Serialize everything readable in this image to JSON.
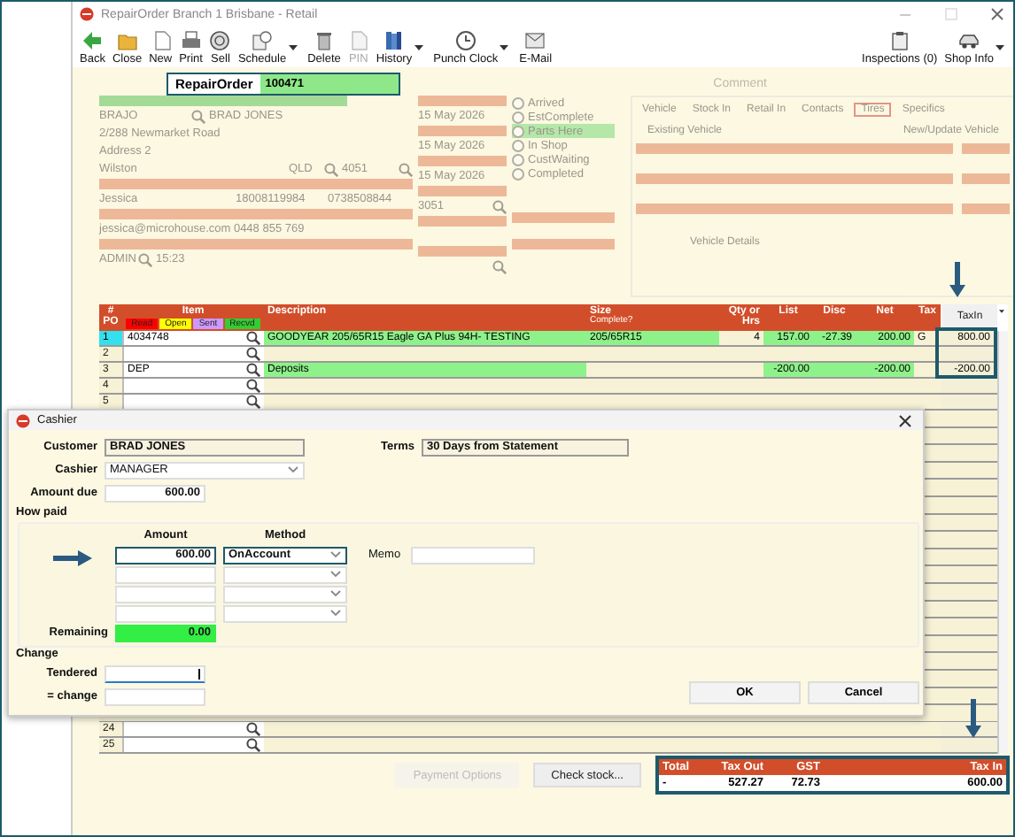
{
  "window": {
    "title": "RepairOrder  Branch 1  Brisbane - Retail"
  },
  "toolbar": [
    {
      "label": "Back",
      "disabled": false,
      "dropdown": false
    },
    {
      "label": "Close",
      "disabled": false,
      "dropdown": false
    },
    {
      "label": "New",
      "disabled": false,
      "dropdown": false
    },
    {
      "label": "Print",
      "disabled": false,
      "dropdown": false
    },
    {
      "label": "Sell",
      "disabled": false,
      "dropdown": false
    },
    {
      "label": "Schedule",
      "disabled": false,
      "dropdown": true
    },
    {
      "label": "Delete",
      "disabled": false,
      "dropdown": false
    },
    {
      "label": "PIN",
      "disabled": true,
      "dropdown": false
    },
    {
      "label": "History",
      "disabled": false,
      "dropdown": true
    },
    {
      "label": "Punch Clock",
      "disabled": false,
      "dropdown": true
    },
    {
      "label": "E-Mail",
      "disabled": false,
      "dropdown": false
    }
  ],
  "toolbar_right": [
    {
      "label": "Inspections (0)",
      "dropdown": false
    },
    {
      "label": "Shop Info",
      "dropdown": true
    }
  ],
  "record": {
    "label": "RepairOrder",
    "number": "100471"
  },
  "background": {
    "comment_label": "Comment",
    "customer_code": "BRAJO",
    "customer_name": "BRAD JONES",
    "address_1": "2/288 Newmarket Road",
    "address_2": "Address 2",
    "suburb": "Wilston",
    "state": "QLD",
    "postcode": "4051",
    "contact": "Jessica",
    "phone_1": "18008119984",
    "phone_2": "0738508844",
    "email": "jessica@microhouse.com 0448 855 769",
    "user": "ADMIN",
    "time": "15:23",
    "dates": [
      "15 May 2026",
      "15 May 2026",
      "15 May 2026"
    ],
    "code": "3051",
    "statuses": [
      {
        "label": "Arrived",
        "selected": false
      },
      {
        "label": "EstComplete",
        "selected": false
      },
      {
        "label": "Parts Here",
        "selected": true
      },
      {
        "label": "In Shop",
        "selected": false
      },
      {
        "label": "CustWaiting",
        "selected": false
      },
      {
        "label": "Completed",
        "selected": false
      }
    ],
    "tabs": [
      {
        "label": "Vehicle",
        "selected": false
      },
      {
        "label": "Stock In",
        "selected": false
      },
      {
        "label": "Retail In",
        "selected": false
      },
      {
        "label": "Contacts",
        "selected": false
      },
      {
        "label": "Tires",
        "selected": true
      },
      {
        "label": "Specifics",
        "selected": false
      }
    ],
    "vehicle_buttons": [
      "Existing Vehicle",
      "New/Update Vehicle"
    ],
    "details_button": "Vehicle Details"
  },
  "grid": {
    "columns": [
      {
        "label": "#",
        "sublabel": "PO"
      },
      {
        "label": "Item"
      },
      {
        "label": "Description"
      },
      {
        "label": "Size",
        "sublabel": "Complete?"
      },
      {
        "label": "Qty or Hrs"
      },
      {
        "label": "List"
      },
      {
        "label": "Disc"
      },
      {
        "label": "Net"
      },
      {
        "label": "Tax"
      },
      {
        "label": "TaxIn"
      }
    ],
    "legend": [
      {
        "label": "Read",
        "color": "#ff0000"
      },
      {
        "label": "Open",
        "color": "#ffff00"
      },
      {
        "label": "Sent",
        "color": "#cc99ff"
      },
      {
        "label": "Recvd",
        "color": "#33cc33"
      }
    ],
    "rows": [
      {
        "number": "1",
        "selected": true,
        "matched": true,
        "item": "4034748",
        "description": "GOODYEAR 205/65R15 Eagle GA Plus 94H- TESTING",
        "size": "205/65R15",
        "qty": "4",
        "list": "157.00",
        "disc": "-27.39",
        "net": "200.00",
        "tax": "G",
        "taxin": "800.00"
      },
      {
        "number": "2",
        "selected": false,
        "matched": false
      },
      {
        "number": "3",
        "selected": false,
        "matched": true,
        "item": "DEP",
        "description": "Deposits",
        "list": "-200.00",
        "net": "-200.00",
        "taxin": "-200.00"
      },
      {
        "number": "4",
        "selected": false,
        "matched": false
      },
      {
        "number": "5",
        "selected": false,
        "matched": false
      }
    ],
    "bottom_rows": [
      {
        "number": "24",
        "selected": false,
        "matched": false
      },
      {
        "number": "25",
        "selected": false,
        "matched": false
      }
    ]
  },
  "actions": [
    {
      "label": "Payment Options",
      "disabled": true
    },
    {
      "label": "Check stock...",
      "disabled": false
    }
  ],
  "totals": {
    "columns": [
      "Total",
      "Tax Out",
      "GST",
      "Tax In"
    ],
    "values": [
      "-",
      "527.27",
      "72.73",
      "600.00"
    ]
  },
  "cashier": {
    "title": "Cashier",
    "customer_label": "Customer",
    "customer": "BRAD JONES",
    "terms_label": "Terms",
    "terms": "30 Days from Statement",
    "cashier_label": "Cashier",
    "cashier": "MANAGER",
    "amount_due_label": "Amount due",
    "amount_due": "600.00",
    "how_paid_label": "How paid",
    "amount_header": "Amount",
    "method_header": "Method",
    "payments": [
      {
        "amount": "600.00",
        "method": "OnAccount",
        "selected": true
      },
      {
        "selected": false
      },
      {
        "selected": false
      },
      {
        "selected": false
      }
    ],
    "memo_label": "Memo",
    "remaining_label": "Remaining",
    "remaining": "0.00",
    "change_label": "Change",
    "tendered_label": "Tendered",
    "tendered_focused": true,
    "change_field_label": "= change",
    "buttons": [
      "OK",
      "Cancel"
    ]
  }
}
